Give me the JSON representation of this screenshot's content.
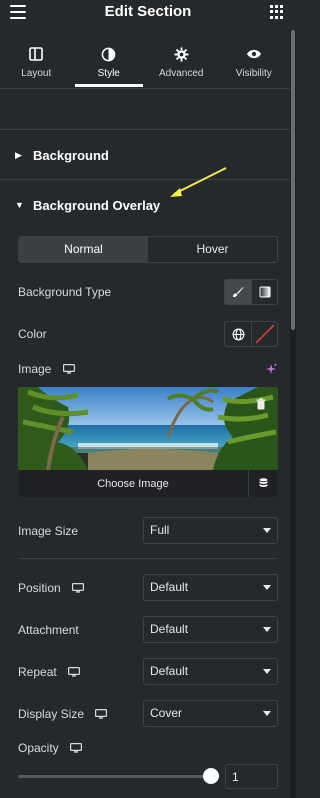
{
  "header": {
    "title": "Edit Section",
    "menu_icon": "hamburger-icon",
    "apps_icon": "grid-icon"
  },
  "tabs": [
    {
      "label": "Layout",
      "icon": "layout-icon",
      "active": false
    },
    {
      "label": "Style",
      "icon": "contrast-icon",
      "active": true
    },
    {
      "label": "Advanced",
      "icon": "gear-icon",
      "active": false
    },
    {
      "label": "Visibility",
      "icon": "eye-icon",
      "active": false
    }
  ],
  "sections": {
    "background": {
      "title": "Background",
      "expanded": false
    },
    "overlay": {
      "title": "Background Overlay",
      "expanded": true
    }
  },
  "state_toggle": {
    "options": [
      "Normal",
      "Hover"
    ],
    "selected": "Normal"
  },
  "fields": {
    "background_type": {
      "label": "Background Type",
      "options_icons": [
        "brush-icon",
        "gradient-icon"
      ],
      "selected": "classic"
    },
    "color": {
      "label": "Color",
      "icons": [
        "globe-icon",
        "clear-color-icon"
      ]
    },
    "image": {
      "label": "Image",
      "choose_label": "Choose Image",
      "responsive_icon": "monitor-icon",
      "ai_icon": "sparkle-icon"
    },
    "image_size": {
      "label": "Image Size",
      "value": "Full"
    },
    "position": {
      "label": "Position",
      "value": "Default"
    },
    "attachment": {
      "label": "Attachment",
      "value": "Default"
    },
    "repeat": {
      "label": "Repeat",
      "value": "Default"
    },
    "display_size": {
      "label": "Display Size",
      "value": "Cover"
    },
    "opacity": {
      "label": "Opacity",
      "value": "1",
      "slider_fraction": 1
    }
  },
  "colors": {
    "background": "#26292c",
    "border": "#3f4347",
    "active_toggle": "#3c4045",
    "arrow": "#f1ee4a"
  }
}
